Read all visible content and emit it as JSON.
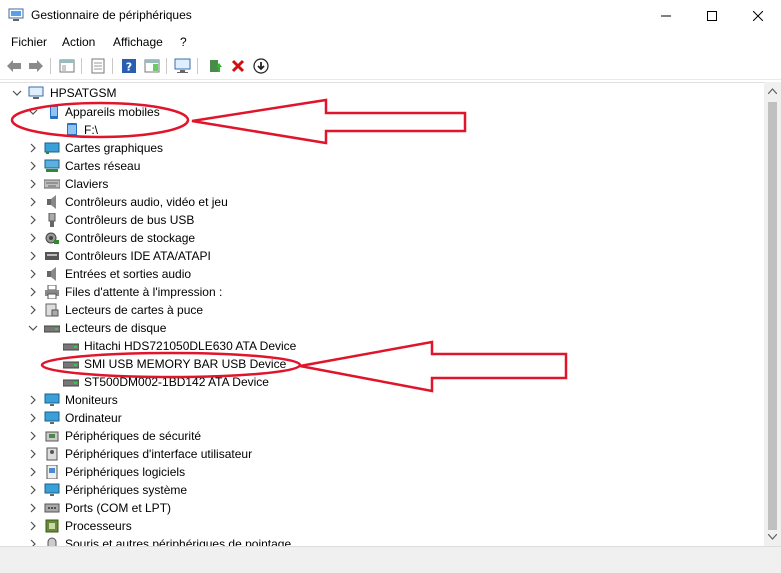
{
  "window": {
    "title": "Gestionnaire de périphériques"
  },
  "menu": {
    "items": [
      "Fichier",
      "Action",
      "Affichage",
      "?"
    ]
  },
  "tree": {
    "root": "HPSATGSM",
    "items": [
      {
        "label": "Appareils mobiles",
        "expanded": true,
        "icon": "mobile-device-icon"
      },
      {
        "label": "F:\\",
        "child": true,
        "icon": "mobile-device-icon"
      },
      {
        "label": "Cartes graphiques",
        "icon": "display-adapter-icon"
      },
      {
        "label": "Cartes réseau",
        "icon": "network-adapter-icon"
      },
      {
        "label": "Claviers",
        "icon": "keyboard-icon"
      },
      {
        "label": "Contrôleurs audio, vidéo et jeu",
        "icon": "speaker-icon"
      },
      {
        "label": "Contrôleurs de bus USB",
        "icon": "usb-icon"
      },
      {
        "label": "Contrôleurs de stockage",
        "icon": "storage-controller-icon"
      },
      {
        "label": "Contrôleurs IDE ATA/ATAPI",
        "icon": "ide-controller-icon"
      },
      {
        "label": "Entrées et sorties audio",
        "icon": "speaker-icon"
      },
      {
        "label": "Files d'attente à l'impression :",
        "icon": "printer-icon"
      },
      {
        "label": "Lecteurs de cartes à puce",
        "icon": "smartcard-icon"
      },
      {
        "label": "Lecteurs de disque",
        "expanded": true,
        "icon": "disk-drive-icon"
      },
      {
        "label": "Hitachi HDS721050DLE630 ATA Device",
        "child": true,
        "icon": "disk-drive-icon"
      },
      {
        "label": "SMI USB MEMORY BAR USB Device",
        "child": true,
        "icon": "disk-drive-icon"
      },
      {
        "label": "ST500DM002-1BD142 ATA Device",
        "child": true,
        "icon": "disk-drive-icon"
      },
      {
        "label": "Moniteurs",
        "icon": "monitor-icon"
      },
      {
        "label": "Ordinateur",
        "icon": "computer-icon"
      },
      {
        "label": "Périphériques de sécurité",
        "icon": "security-device-icon"
      },
      {
        "label": "Périphériques d'interface utilisateur",
        "icon": "hid-icon"
      },
      {
        "label": "Périphériques logiciels",
        "icon": "software-device-icon"
      },
      {
        "label": "Périphériques système",
        "icon": "system-device-icon"
      },
      {
        "label": "Ports (COM et LPT)",
        "icon": "port-icon"
      },
      {
        "label": "Processeurs",
        "icon": "processor-icon"
      },
      {
        "label": "Souris et autres périphériques de pointage",
        "icon": "mouse-icon"
      }
    ]
  },
  "colors": {
    "annotation": "#e0142a",
    "selection": "#cce8ff",
    "folder_blue": "#2b6fc2"
  }
}
